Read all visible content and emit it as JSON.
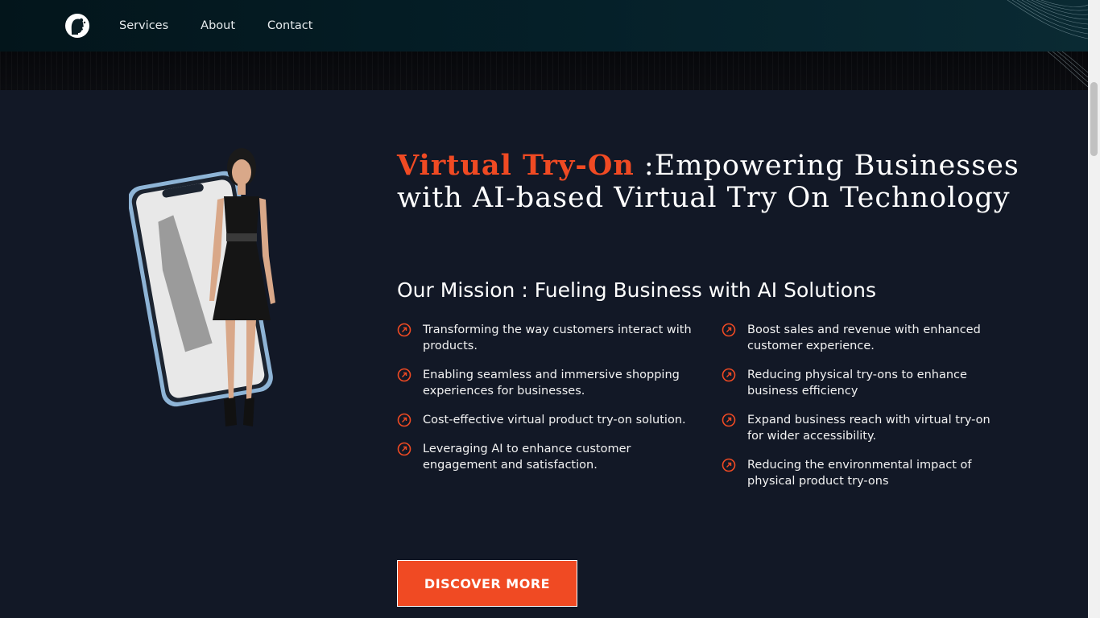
{
  "nav": {
    "items": [
      {
        "label": "Services"
      },
      {
        "label": "About"
      },
      {
        "label": "Contact"
      }
    ]
  },
  "hero": {
    "title_accent": "Virtual Try-On",
    "title_rest": " :Empowering Businesses with AI-based Virtual Try On Technology",
    "mission_heading": "Our Mission : Fueling Business with AI Solutions",
    "left_points": [
      "Transforming the way customers interact with products.",
      "Enabling seamless and immersive shopping experiences for businesses.",
      "Cost-effective virtual product try-on solution.",
      "Leveraging AI to enhance customer engagement and satisfaction."
    ],
    "right_points": [
      "Boost sales and revenue with enhanced customer experience.",
      "Reducing physical try-ons to enhance business efficiency",
      "Expand business reach with virtual try-on for wider accessibility.",
      "Reducing the environmental impact of physical product try-ons"
    ],
    "cta_label": "DISCOVER MORE"
  },
  "icons": {
    "logo": "head-logo-icon",
    "bullet": "arrow-up-right-circle-icon"
  },
  "colors": {
    "accent": "#f04a23",
    "background": "#121826",
    "header": "#052029"
  }
}
